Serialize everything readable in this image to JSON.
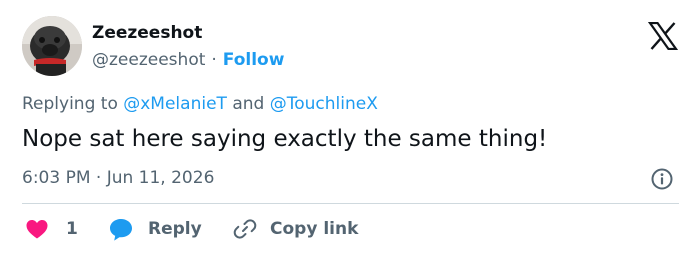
{
  "author": {
    "display_name": "Zeezeeshot",
    "handle": "@zeezeeshot",
    "separator": "·",
    "follow_label": "Follow"
  },
  "brand": {
    "logo_icon": "x-logo-icon"
  },
  "reply_context": {
    "prefix": "Replying to ",
    "mention_1": "@xMelanieT",
    "conjunction": " and ",
    "mention_2": "@TouchlineX"
  },
  "tweet": {
    "text": "Nope sat here saying exactly the same thing!",
    "timestamp": "6:03 PM · Jun 11, 2026"
  },
  "actions": {
    "like_count": "1",
    "reply_label": "Reply",
    "copy_link_label": "Copy link"
  },
  "colors": {
    "accent": "#1d9bf0",
    "like": "#f91880",
    "muted_text": "#536471",
    "primary_text": "#0f1419",
    "divider": "#cfd9de"
  }
}
